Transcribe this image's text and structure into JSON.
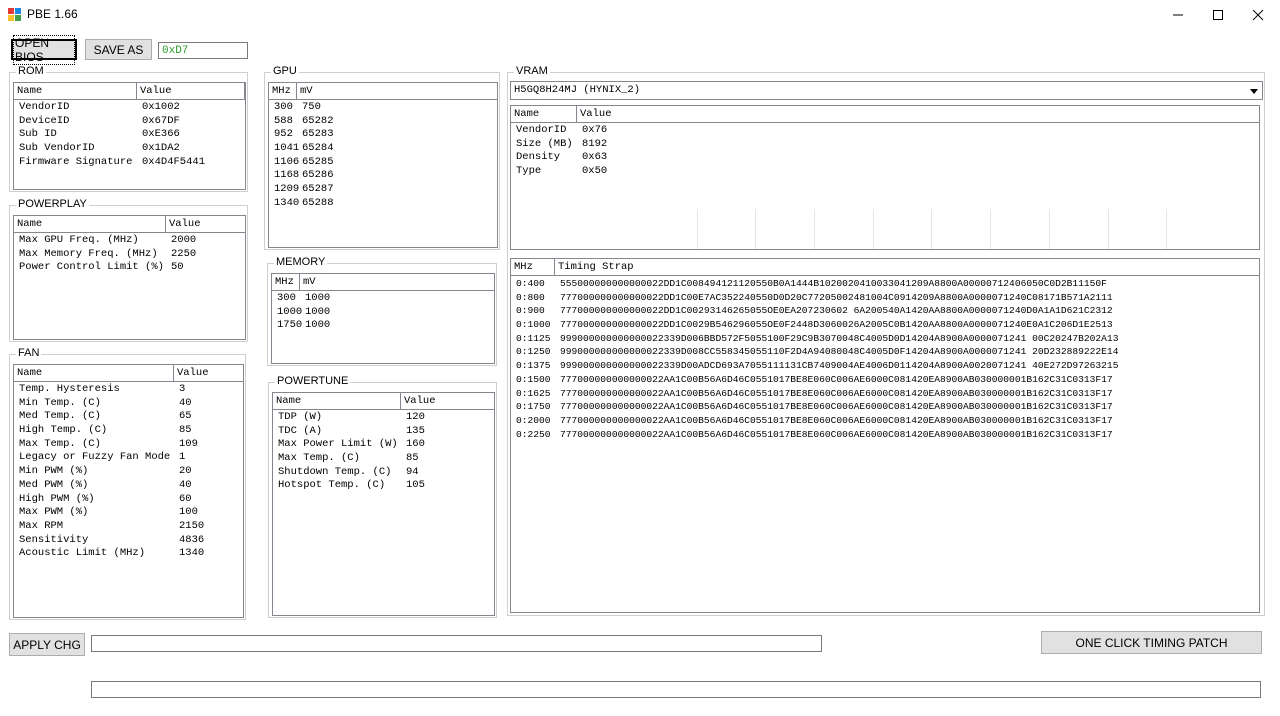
{
  "window": {
    "title": "PBE 1.66"
  },
  "toolbar": {
    "open_label": "OPEN BIOS",
    "save_label": "SAVE AS",
    "hex_value": "0xD7"
  },
  "rom": {
    "title": "ROM",
    "headers": [
      "Name",
      "Value"
    ],
    "rows": [
      [
        "VendorID",
        "0x1002"
      ],
      [
        "DeviceID",
        "0x67DF"
      ],
      [
        "Sub ID",
        "0xE366"
      ],
      [
        "Sub VendorID",
        "0x1DA2"
      ],
      [
        "Firmware Signature",
        "0x4D4F5441"
      ]
    ]
  },
  "powerplay": {
    "title": "POWERPLAY",
    "headers": [
      "Name",
      "Value"
    ],
    "rows": [
      [
        "Max GPU Freq. (MHz)",
        "2000"
      ],
      [
        "Max Memory Freq. (MHz)",
        "2250"
      ],
      [
        "Power Control Limit (%)",
        "50"
      ]
    ]
  },
  "fan": {
    "title": "FAN",
    "headers": [
      "Name",
      "Value"
    ],
    "rows": [
      [
        "Temp. Hysteresis",
        "3"
      ],
      [
        "Min Temp. (C)",
        "40"
      ],
      [
        "Med Temp. (C)",
        "65"
      ],
      [
        "High Temp. (C)",
        "85"
      ],
      [
        "Max Temp. (C)",
        "109"
      ],
      [
        "Legacy or Fuzzy Fan Mode",
        "1"
      ],
      [
        "Min PWM (%)",
        "20"
      ],
      [
        "Med PWM (%)",
        "40"
      ],
      [
        "High PWM (%)",
        "60"
      ],
      [
        "Max PWM (%)",
        "100"
      ],
      [
        "Max RPM",
        "2150"
      ],
      [
        "Sensitivity",
        "4836"
      ],
      [
        "Acoustic Limit (MHz)",
        "1340"
      ]
    ]
  },
  "gpu": {
    "title": "GPU",
    "headers": [
      "MHz",
      "mV"
    ],
    "rows": [
      [
        "300",
        "750"
      ],
      [
        "588",
        "65282"
      ],
      [
        "952",
        "65283"
      ],
      [
        "1041",
        "65284"
      ],
      [
        "1106",
        "65285"
      ],
      [
        "1168",
        "65286"
      ],
      [
        "1209",
        "65287"
      ],
      [
        "1340",
        "65288"
      ]
    ]
  },
  "memory": {
    "title": "MEMORY",
    "headers": [
      "MHz",
      "mV"
    ],
    "rows": [
      [
        "300",
        "1000"
      ],
      [
        "1000",
        "1000"
      ],
      [
        "1750",
        "1000"
      ]
    ]
  },
  "powertune": {
    "title": "POWERTUNE",
    "headers": [
      "Name",
      "Value"
    ],
    "rows": [
      [
        "TDP (W)",
        "120"
      ],
      [
        "TDC (A)",
        "135"
      ],
      [
        "Max Power Limit (W)",
        "160"
      ],
      [
        "Max Temp. (C)",
        "85"
      ],
      [
        "Shutdown Temp. (C)",
        "94"
      ],
      [
        "Hotspot Temp. (C)",
        "105"
      ]
    ]
  },
  "vram": {
    "title": "VRAM",
    "selected_chip": "H5GQ8H24MJ (HYNIX_2)",
    "headers": [
      "Name",
      "Value"
    ],
    "rows": [
      [
        "VendorID",
        "0x76"
      ],
      [
        "Size (MB)",
        "8192"
      ],
      [
        "Density",
        "0x63"
      ],
      [
        "Type",
        "0x50"
      ]
    ],
    "timing_headers": [
      "MHz",
      "Timing Strap"
    ],
    "timing_rows": [
      [
        "0:400",
        "555000000000000022DD1C008494121120550B0A1444B1020020410033041209A8800A00000712406050C0D2B11150F"
      ],
      [
        "0:800",
        "777000000000000022DD1C00E7AC352240550D0D20C77205002481004C0914209A8800A0000071240C08171B571A2111"
      ],
      [
        "0:900",
        "777000000000000022DD1C00293146265055OE0EA207230602 6A200540A1420AA8800A0000071240D0A1A1D621C2312"
      ],
      [
        "0:1000",
        "777000000000000022DD1C0029B546296055OE0F2448D3060026A2005C0B1420AA8800A0000071240E0A1C206D1E2513"
      ],
      [
        "0:1125",
        "999000000000000022339D006BBD572F5055100F29C9B3070048C4005D0D14204A8900A0000071241 00C20247B202A13"
      ],
      [
        "0:1250",
        "999000000000000022339D008CC558345055110F2D4A94080048C4005D0F14204A8900A0000071241 20D232889222E14"
      ],
      [
        "0:1375",
        "999000000000000022339D00ADCD693A7055111131CB7409004AE4006D0114204A8900A0020071241 40E272D97263215"
      ],
      [
        "0:1500",
        "777000000000000022AA1C00B56A6D46C0551017BE8E060C006AE6000C081420EA8900AB030000001B162C31C0313F17"
      ],
      [
        "0:1625",
        "777000000000000022AA1C00B56A6D46C0551017BE8E060C006AE6000C081420EA8900AB030000001B162C31C0313F17"
      ],
      [
        "0:1750",
        "777000000000000022AA1C00B56A6D46C0551017BE8E060C006AE6000C081420EA8900AB030000001B162C31C0313F17"
      ],
      [
        "0:2000",
        "777000000000000022AA1C00B56A6D46C0551017BE8E060C006AE6000C081420EA8900AB030000001B162C31C0313F17"
      ],
      [
        "0:2250",
        "777000000000000022AA1C00B56A6D46C0551017BE8E060C006AE6000C081420EA8900AB030000001B162C31C0313F17"
      ]
    ]
  },
  "footer": {
    "apply_label": "APPLY CHG",
    "timing_patch_label": "ONE CLICK TIMING PATCH"
  }
}
